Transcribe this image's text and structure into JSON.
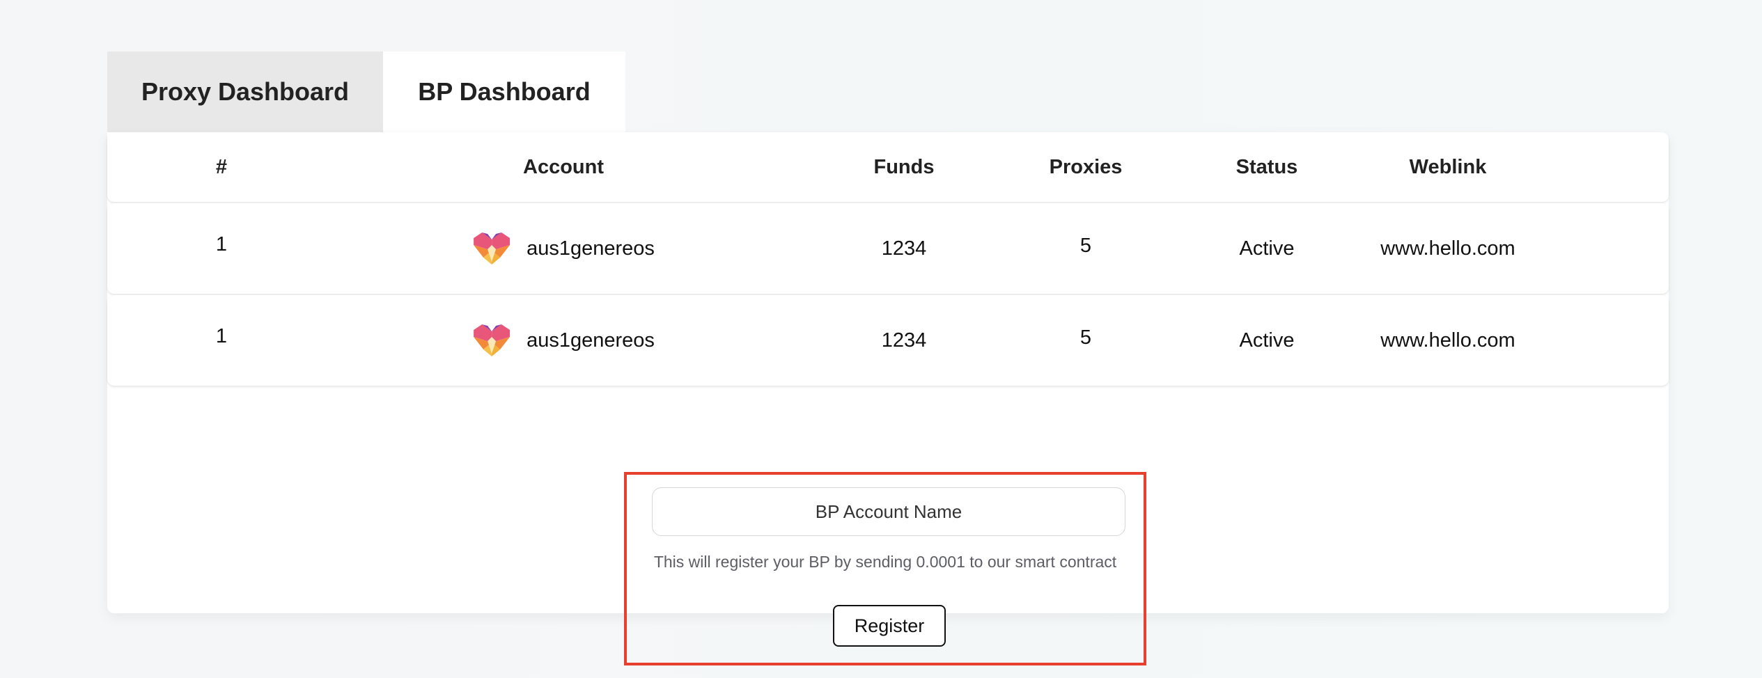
{
  "tabs": {
    "proxy": "Proxy Dashboard",
    "bp": "BP Dashboard"
  },
  "table": {
    "headers": {
      "num": "#",
      "account": "Account",
      "funds": "Funds",
      "proxies": "Proxies",
      "status": "Status",
      "weblink": "Weblink"
    },
    "rows": [
      {
        "num": "1",
        "account": "aus1genereos",
        "funds": "1234",
        "proxies": "5",
        "status": "Active",
        "weblink": "www.hello.com"
      },
      {
        "num": "1",
        "account": "aus1genereos",
        "funds": "1234",
        "proxies": "5",
        "status": "Active",
        "weblink": "www.hello.com"
      }
    ]
  },
  "register": {
    "placeholder": "BP Account Name",
    "hint": "This will register your BP by sending 0.0001 to our smart contract",
    "button": "Register"
  },
  "colors": {
    "highlight_border": "#e8402f",
    "inactive_tab": "#e8e8e8"
  },
  "icons": {
    "account_logo": "genereos-heart-logo-icon"
  }
}
